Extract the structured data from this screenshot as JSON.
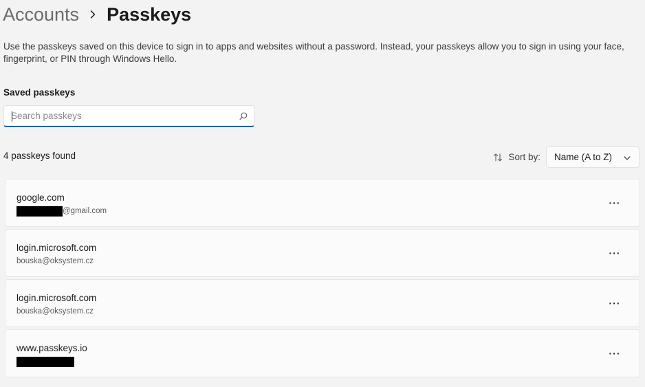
{
  "breadcrumb": {
    "parent": "Accounts",
    "current": "Passkeys"
  },
  "description": "Use the passkeys saved on this device to sign in to apps and websites without a password. Instead, your passkeys allow you to sign in using your face, fingerprint, or PIN through Windows Hello.",
  "saved_title": "Saved passkeys",
  "search": {
    "placeholder": "Search passkeys",
    "value": ""
  },
  "count_text": "4 passkeys found",
  "sort": {
    "label": "Sort by:",
    "value": "Name (A to Z)"
  },
  "passkeys": [
    {
      "site": "google.com",
      "user": "@gmail.com",
      "user_redacted": true
    },
    {
      "site": "login.microsoft.com",
      "user": "bouska@oksystem.cz",
      "user_redacted": false
    },
    {
      "site": "login.microsoft.com",
      "user": "bouska@oksystem.cz",
      "user_redacted": false
    },
    {
      "site": "www.passkeys.io",
      "user": "",
      "user_redacted": true
    }
  ],
  "more_label": "···",
  "icons": {
    "breadcrumb_separator": "chevron-right-icon",
    "search": "search-icon",
    "sort": "sort-icon",
    "dropdown": "chevron-down-icon",
    "more": "more-options-icon"
  },
  "colors": {
    "accent": "#005fb8",
    "background": "#f3f3f3",
    "card": "#fbfbfb",
    "redaction": "#000000"
  }
}
